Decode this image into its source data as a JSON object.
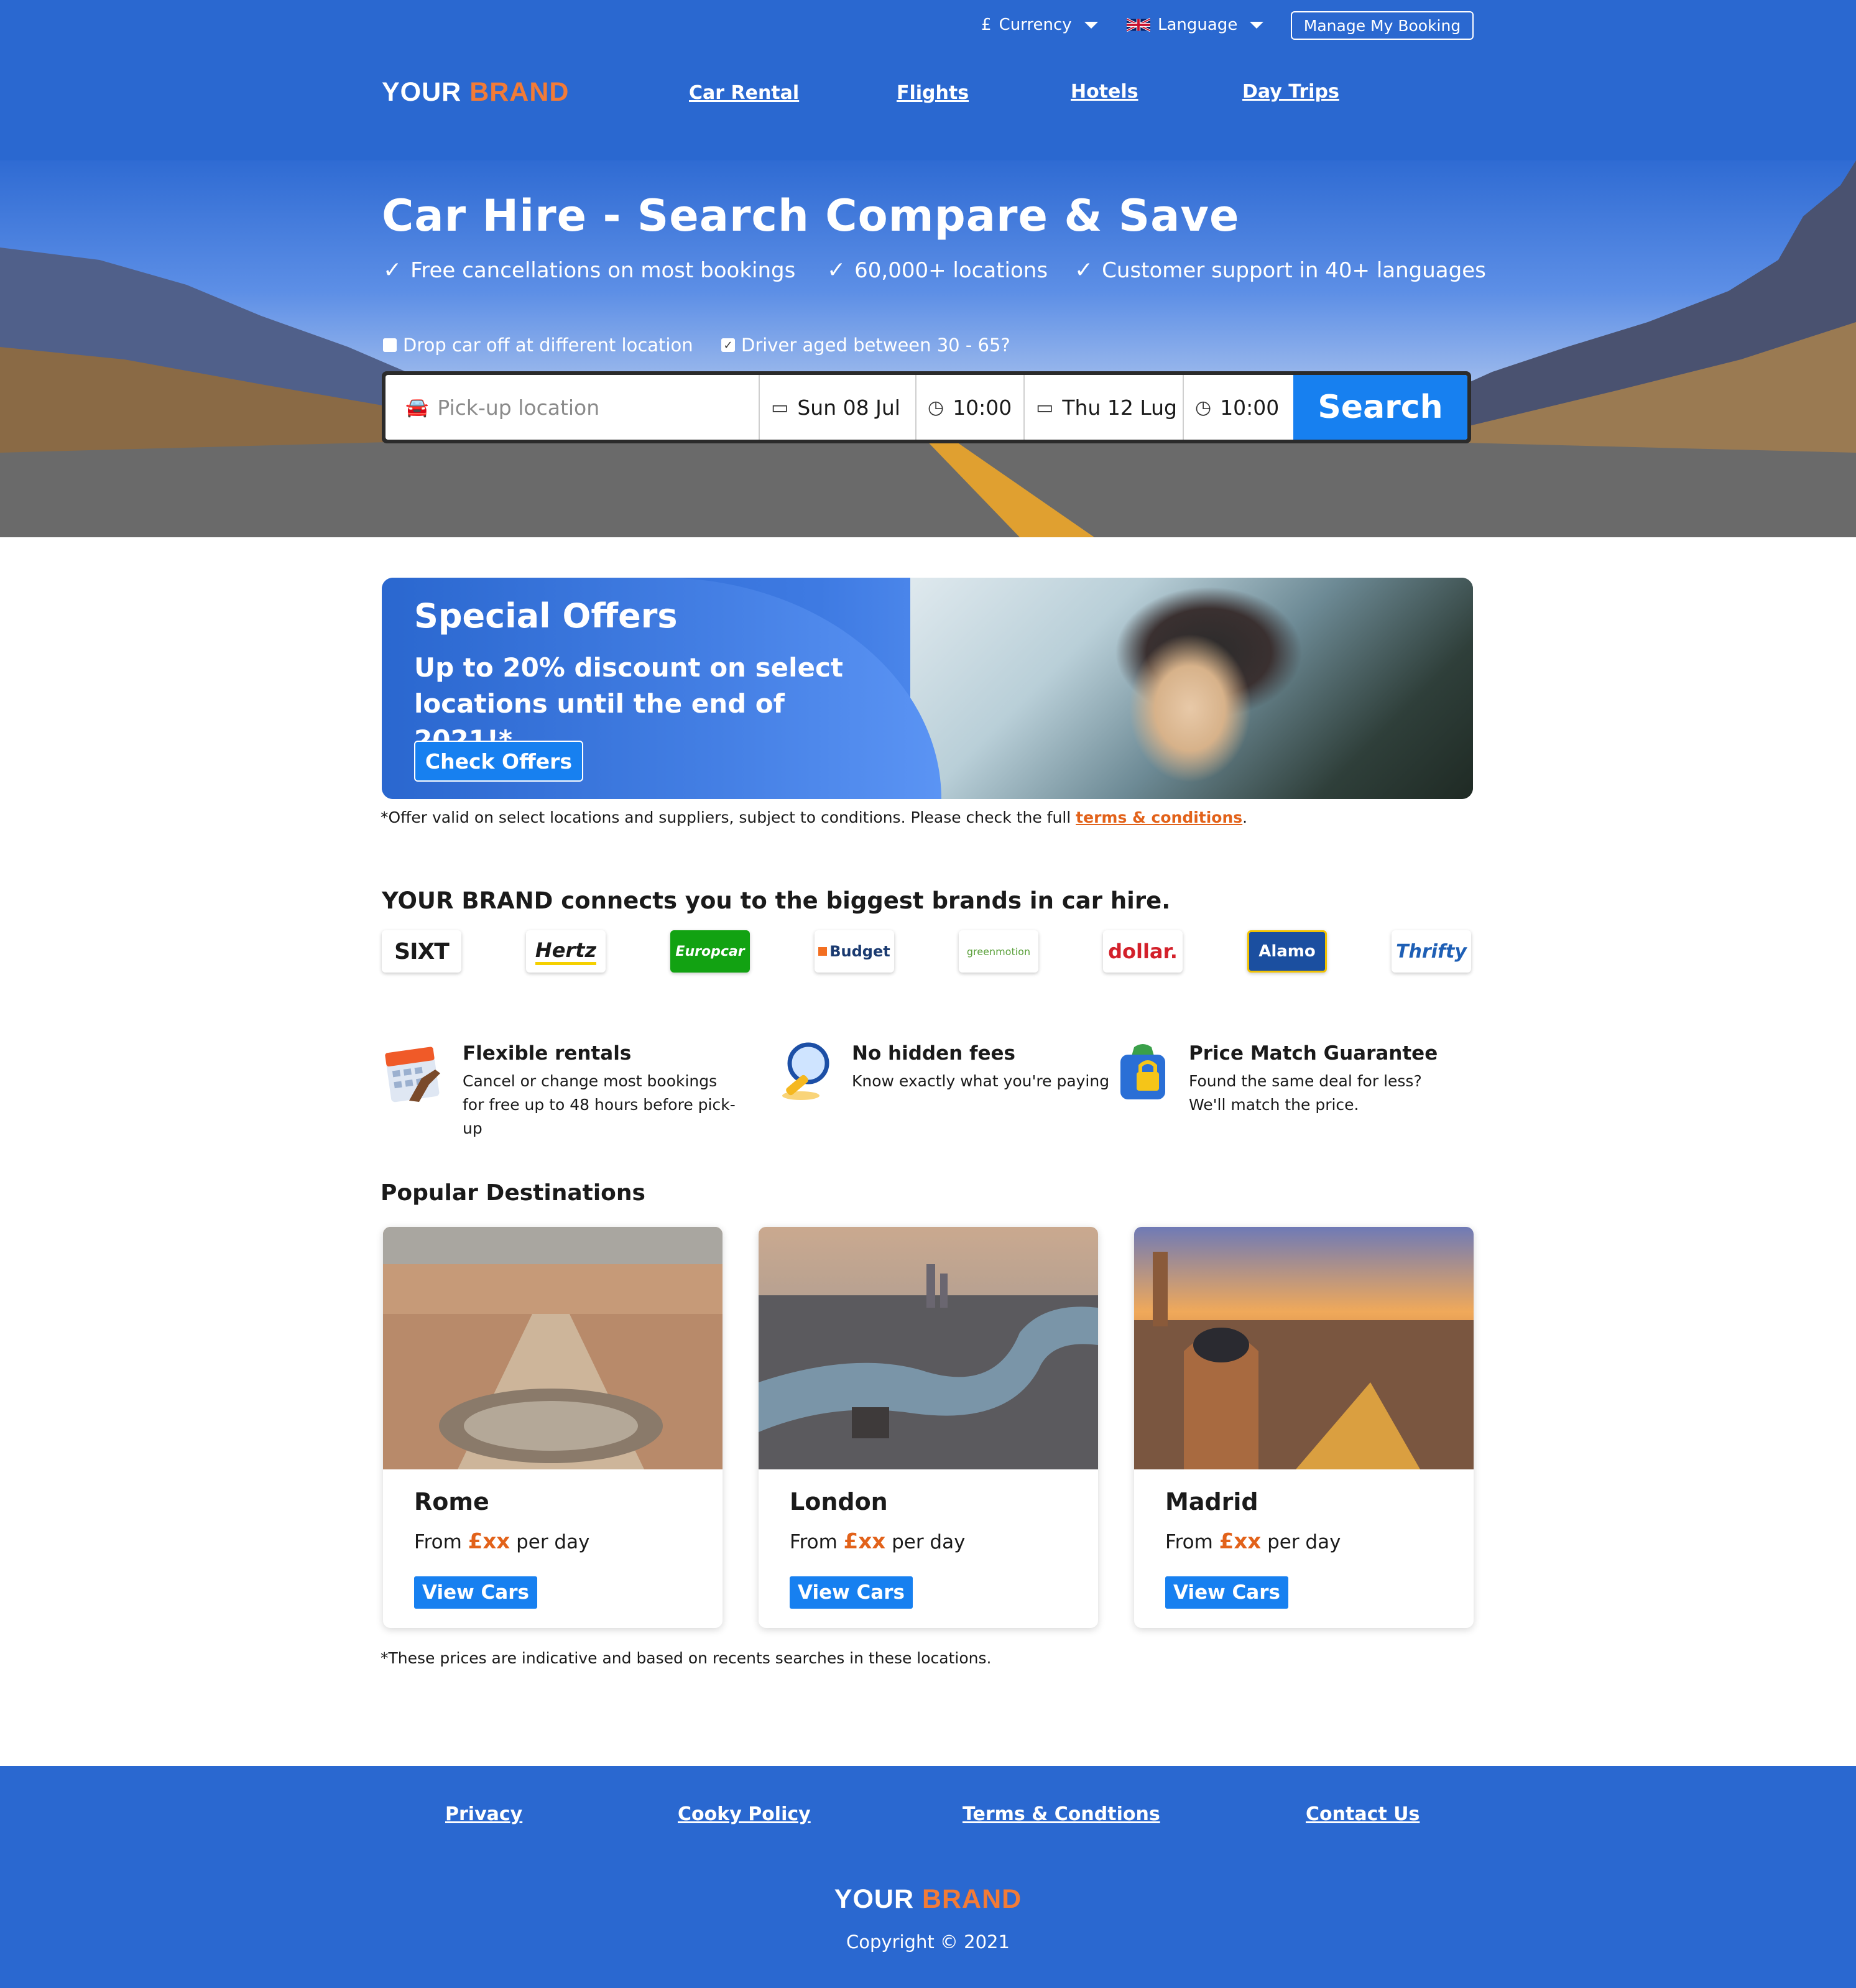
{
  "header": {
    "currency_symbol": "£",
    "currency_label": "Currency",
    "language_label": "Language",
    "manage_booking_label": "Manage My Booking",
    "logo_part1": "YOUR",
    "logo_part2": "BRAND",
    "nav": [
      {
        "label": "Car Rental"
      },
      {
        "label": "Flights"
      },
      {
        "label": "Hotels"
      },
      {
        "label": "Day Trips"
      }
    ]
  },
  "hero": {
    "title": "Car Hire - Search Compare & Save",
    "benefits": [
      "Free cancellations on most bookings",
      "60,000+ locations",
      "Customer support in 40+ languages"
    ],
    "options": {
      "different_location_label": "Drop car off at different location",
      "different_location_checked": false,
      "driver_age_label": "Driver aged between 30 - 65?",
      "driver_age_checked": true
    },
    "search": {
      "pickup_placeholder": "Pick-up location",
      "pickup_date": "Sun 08 Jul",
      "pickup_time": "10:00",
      "dropoff_date": "Thu 12 Lug",
      "dropoff_time": "10:00",
      "search_label": "Search"
    }
  },
  "offer": {
    "title": "Special Offers",
    "subtitle": "Up to 20% discount on select locations until the end of 2021!*",
    "button_label": "Check Offers",
    "note_prefix": "*Offer valid on select locations and suppliers, subject to conditions. Please check the full ",
    "note_link": "terms & conditions",
    "note_suffix": "."
  },
  "brands": {
    "title": "YOUR BRAND connects you to the biggest brands in car hire.",
    "items": [
      {
        "name": "SIXT",
        "color": "#000000",
        "bg": "#ffffff"
      },
      {
        "name": "Hertz",
        "color": "#000000",
        "bg": "#ffffff"
      },
      {
        "name": "Europcar",
        "color": "#ffffff",
        "bg": "#12a212"
      },
      {
        "name": "Budget",
        "color": "#1a3a70",
        "bg": "#ffffff"
      },
      {
        "name": "greenmotion",
        "color": "#5aa03a",
        "bg": "#ffffff"
      },
      {
        "name": "dollar.",
        "color": "#d3202a",
        "bg": "#ffffff"
      },
      {
        "name": "Alamo",
        "color": "#ffffff",
        "bg": "#1b4fa0"
      },
      {
        "name": "Thrifty",
        "color": "#1e5fb5",
        "bg": "#ffffff"
      }
    ]
  },
  "features": [
    {
      "title": "Flexible rentals",
      "desc": "Cancel or change most bookings for free up to 48 hours before pick-up",
      "icon": "calendar-icon"
    },
    {
      "title": "No hidden fees",
      "desc": "Know exactly what you're paying",
      "icon": "magnifier-icon"
    },
    {
      "title": "Price Match Guarantee",
      "desc": "Found the same deal for less? We'll match the price.",
      "icon": "padlock-bag-icon"
    }
  ],
  "destinations": {
    "title": "Popular Destinations",
    "price_from": "From",
    "price_amount": "£xx",
    "price_per": "per day",
    "button_label": "View Cars",
    "items": [
      {
        "city": "Rome"
      },
      {
        "city": "London"
      },
      {
        "city": "Madrid"
      }
    ],
    "note": "*These prices are indicative and based on recents searches in these locations."
  },
  "footer": {
    "links": [
      "Privacy",
      "Cooky Policy",
      "Terms & Condtions",
      "Contact Us"
    ],
    "logo_part1": "YOUR",
    "logo_part2": "BRAND",
    "copyright": "Copyright © 2021"
  },
  "colors": {
    "brand_blue": "#2a68d0",
    "accent_blue": "#1780f0",
    "accent_orange": "#f27b37",
    "price_orange": "#e2621a"
  }
}
